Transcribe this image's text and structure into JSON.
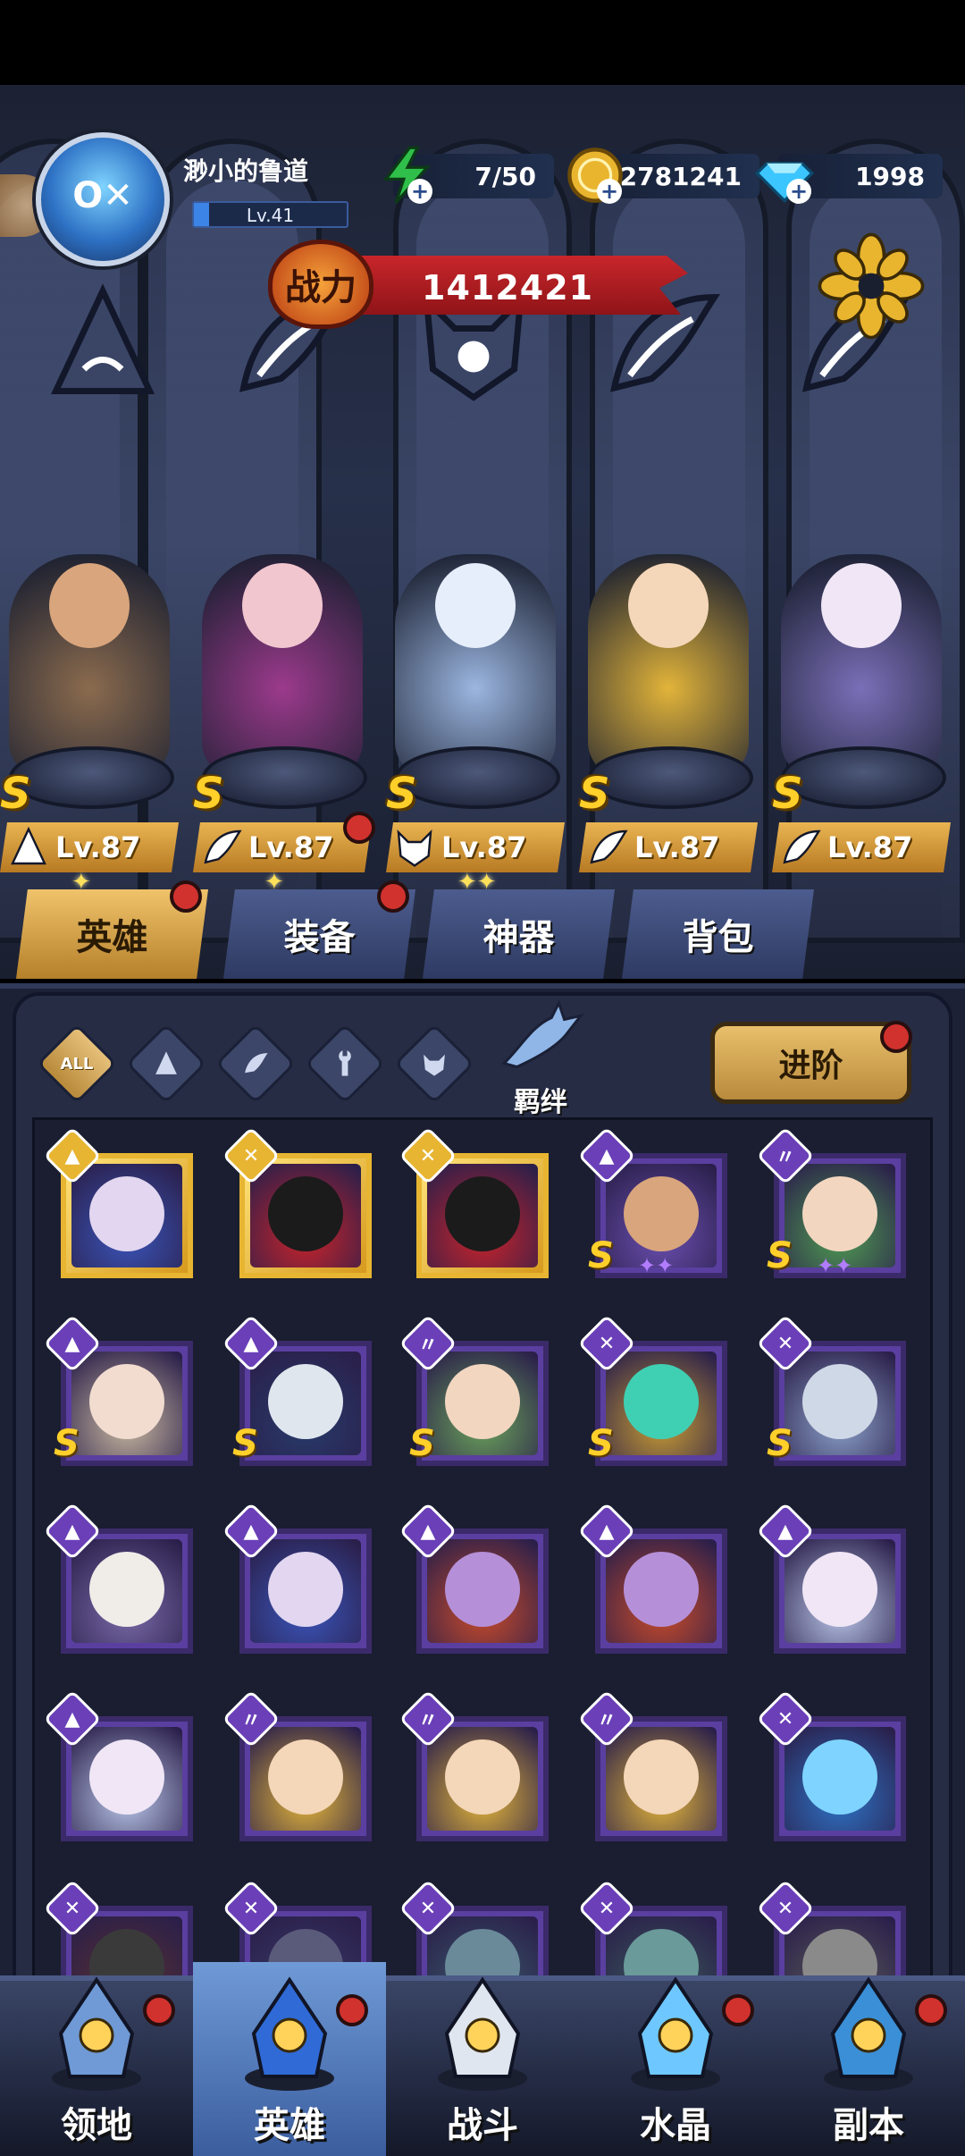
{
  "player": {
    "name": "渺小的鲁道",
    "level": "Lv.41",
    "level_progress": 0.1,
    "avatar_icon": "robot-fishbowl-avatar"
  },
  "resources": [
    {
      "name": "energy",
      "icon": "lightning-icon",
      "value": "7/50",
      "color": "#2fbf4a"
    },
    {
      "name": "gold",
      "icon": "gold-coin-icon",
      "value": "2781241",
      "color": "#e9b52f"
    },
    {
      "name": "diamond",
      "icon": "diamond-icon",
      "value": "1998",
      "color": "#3cc6ff"
    }
  ],
  "power": {
    "label": "战力",
    "value": "1412421"
  },
  "lineup": [
    {
      "name": "barbarian",
      "class_icon": "mage-hat-icon",
      "rank": "S",
      "level": "Lv.87",
      "stars": "✦",
      "notify": false,
      "color": "#8b6b4e",
      "skin": "#d9a57c"
    },
    {
      "name": "succubus",
      "class_icon": "wing-icon",
      "rank": "S",
      "level": "Lv.87",
      "stars": "✦",
      "notify": true,
      "color": "#9c3a8c",
      "skin": "#f1c6cf"
    },
    {
      "name": "crane-ninja",
      "class_icon": "demon-mask-icon",
      "rank": "S",
      "level": "Lv.87",
      "stars": "✦✦",
      "notify": false,
      "color": "#9bb6e0",
      "skin": "#e6eefc"
    },
    {
      "name": "athena",
      "class_icon": "wing-icon",
      "rank": "S",
      "level": "Lv.87",
      "stars": "",
      "notify": false,
      "color": "#e2b43a",
      "skin": "#f4d6b8"
    },
    {
      "name": "moon-priestess",
      "class_icon": "wing-icon",
      "rank": "S",
      "level": "Lv.87",
      "stars": "",
      "notify": false,
      "color": "#7a6fb8",
      "skin": "#f0e6f6"
    }
  ],
  "slot_emblems": [
    "mage-hat-icon",
    "wing-icon",
    "demon-mask-icon",
    "wing-icon",
    "wing-icon"
  ],
  "tabs": [
    {
      "label": "英雄",
      "active": true,
      "notify": true
    },
    {
      "label": "装备",
      "active": false,
      "notify": true
    },
    {
      "label": "神器",
      "active": false,
      "notify": false
    },
    {
      "label": "背包",
      "active": false,
      "notify": false
    }
  ],
  "filters": {
    "all_label": "ALL",
    "icons": [
      "mage-hat-icon",
      "wing-icon",
      "wrench-icon",
      "demon-mask-icon"
    ],
    "bond_label": "羁绊",
    "advance_label": "进阶"
  },
  "hero_cards": [
    {
      "cls": "mage",
      "glyph": "▲",
      "gold": true,
      "rank": "",
      "stars": "",
      "color": "#3a54b8",
      "skin": "#e2d6f0"
    },
    {
      "cls": "tech",
      "glyph": "✕",
      "gold": true,
      "rank": "",
      "stars": "",
      "color": "#c8232a",
      "skin": "#1b1b1b"
    },
    {
      "cls": "tech",
      "glyph": "✕",
      "gold": true,
      "rank": "",
      "stars": "",
      "color": "#c8232a",
      "skin": "#1b1b1b"
    },
    {
      "cls": "mage",
      "glyph": "▲",
      "gold": false,
      "rank": "S",
      "stars": "✦✦",
      "color": "#6a4fb0",
      "skin": "#d9a57c"
    },
    {
      "cls": "wing",
      "glyph": "〃",
      "gold": false,
      "rank": "S",
      "stars": "✦✦",
      "color": "#4f9b52",
      "skin": "#f2d6c0"
    },
    {
      "cls": "mage",
      "glyph": "▲",
      "gold": false,
      "rank": "S",
      "stars": "",
      "color": "#c8b8a0",
      "skin": "#f2dcd0"
    },
    {
      "cls": "mage",
      "glyph": "▲",
      "gold": false,
      "rank": "S",
      "stars": "",
      "color": "#283a6a",
      "skin": "#dfe6ee"
    },
    {
      "cls": "wing",
      "glyph": "〃",
      "gold": false,
      "rank": "S",
      "stars": "",
      "color": "#6aa25a",
      "skin": "#f2d6c0"
    },
    {
      "cls": "tech",
      "glyph": "✕",
      "gold": false,
      "rank": "S",
      "stars": "",
      "color": "#c79b34",
      "skin": "#3fd0b4"
    },
    {
      "cls": "tech",
      "glyph": "✕",
      "gold": false,
      "rank": "S",
      "stars": "",
      "color": "#8aa0c8",
      "skin": "#cfd8e6"
    },
    {
      "cls": "mage",
      "glyph": "▲",
      "gold": false,
      "rank": "",
      "stars": "",
      "color": "#7a6aa8",
      "skin": "#f0ece8"
    },
    {
      "cls": "mage",
      "glyph": "▲",
      "gold": false,
      "rank": "",
      "stars": "",
      "color": "#3a54b8",
      "skin": "#e2d6f0"
    },
    {
      "cls": "mage",
      "glyph": "▲",
      "gold": false,
      "rank": "",
      "stars": "",
      "color": "#c84a2a",
      "skin": "#b590d8"
    },
    {
      "cls": "mage",
      "glyph": "▲",
      "gold": false,
      "rank": "",
      "stars": "",
      "color": "#c84a2a",
      "skin": "#b590d8"
    },
    {
      "cls": "mage",
      "glyph": "▲",
      "gold": false,
      "rank": "",
      "stars": "",
      "color": "#b9c6e8",
      "skin": "#f0e6f6"
    },
    {
      "cls": "mage",
      "glyph": "▲",
      "gold": false,
      "rank": "",
      "stars": "",
      "color": "#b9c6e8",
      "skin": "#f0e6f6"
    },
    {
      "cls": "wing",
      "glyph": "〃",
      "gold": false,
      "rank": "",
      "stars": "",
      "color": "#e2b43a",
      "skin": "#f4d6b8"
    },
    {
      "cls": "wing",
      "glyph": "〃",
      "gold": false,
      "rank": "",
      "stars": "",
      "color": "#e2b43a",
      "skin": "#f4d6b8"
    },
    {
      "cls": "wing",
      "glyph": "〃",
      "gold": false,
      "rank": "",
      "stars": "",
      "color": "#e2b43a",
      "skin": "#f4d6b8"
    },
    {
      "cls": "tech",
      "glyph": "✕",
      "gold": false,
      "rank": "",
      "stars": "",
      "color": "#2e72c5",
      "skin": "#7fd4ff"
    },
    {
      "cls": "tech",
      "glyph": "✕",
      "gold": false,
      "rank": "",
      "stars": "",
      "color": "#5a3030",
      "skin": "#3a3a3a"
    },
    {
      "cls": "tech",
      "glyph": "✕",
      "gold": false,
      "rank": "",
      "stars": "",
      "color": "#3a3a6a",
      "skin": "#5a5a7a"
    },
    {
      "cls": "tech",
      "glyph": "✕",
      "gold": false,
      "rank": "",
      "stars": "",
      "color": "#3a5a6a",
      "skin": "#6a8a9a"
    },
    {
      "cls": "tech",
      "glyph": "✕",
      "gold": false,
      "rank": "",
      "stars": "",
      "color": "#3a5a5a",
      "skin": "#6a9a9a"
    },
    {
      "cls": "tech",
      "glyph": "✕",
      "gold": false,
      "rank": "",
      "stars": "",
      "color": "#5a5a5a",
      "skin": "#8a8a8a"
    }
  ],
  "bottom_nav": [
    {
      "label": "领地",
      "icon": "castle-icon",
      "active": false,
      "notify": true
    },
    {
      "label": "英雄",
      "icon": "wizard-hat-icon",
      "active": true,
      "notify": true
    },
    {
      "label": "战斗",
      "icon": "sword-book-icon",
      "active": false,
      "notify": false
    },
    {
      "label": "水晶",
      "icon": "crystal-icon",
      "active": false,
      "notify": true
    },
    {
      "label": "副本",
      "icon": "portal-icon",
      "active": false,
      "notify": true
    }
  ]
}
